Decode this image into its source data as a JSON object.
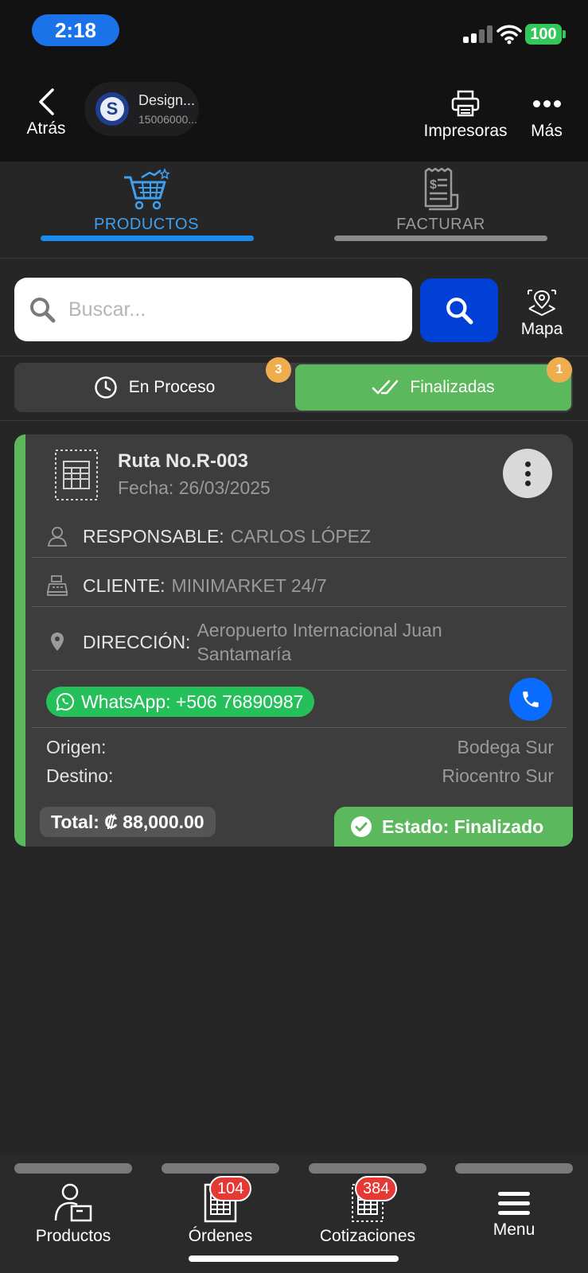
{
  "status_bar": {
    "time": "2:18",
    "battery": "100"
  },
  "header": {
    "back_label": "Atrás",
    "company_name": "Design...",
    "company_id": "15006000...",
    "printers_label": "Impresoras",
    "more_label": "Más"
  },
  "tabs": [
    {
      "label": "PRODUCTOS",
      "active": true
    },
    {
      "label": "FACTURAR",
      "active": false
    }
  ],
  "search": {
    "placeholder": "Buscar...",
    "map_label": "Mapa"
  },
  "segments": {
    "in_process": {
      "label": "En Proceso",
      "count": "3"
    },
    "finished": {
      "label": "Finalizadas",
      "count": "1"
    }
  },
  "route_card": {
    "title": "Ruta No.R-003",
    "date": "Fecha: 26/03/2025",
    "responsible_key": "RESPONSABLE:",
    "responsible_val": "CARLOS LÓPEZ",
    "client_key": "CLIENTE:",
    "client_val": "MINIMARKET 24/7",
    "address_key": "DIRECCIÓN:",
    "address_val": "Aeropuerto Internacional Juan Santamaría",
    "whatsapp": "WhatsApp: +506 76890987",
    "origin_key": "Origen:",
    "origin_val": "Bodega Sur",
    "destination_key": "Destino:",
    "destination_val": "Riocentro Sur",
    "total": "Total: ₡ 88,000.00",
    "status": "Estado: Finalizado"
  },
  "bottom_nav": [
    {
      "label": "Productos"
    },
    {
      "label": "Órdenes",
      "badge": "104"
    },
    {
      "label": "Cotizaciones",
      "badge": "384"
    },
    {
      "label": "Menu"
    }
  ],
  "colors": {
    "accent_blue": "#1a73e8",
    "search_button": "#0040d6",
    "success_green": "#5cb85c",
    "whatsapp_green": "#25c05a",
    "badge_orange": "#f0ad4e",
    "badge_red": "#e53935"
  }
}
